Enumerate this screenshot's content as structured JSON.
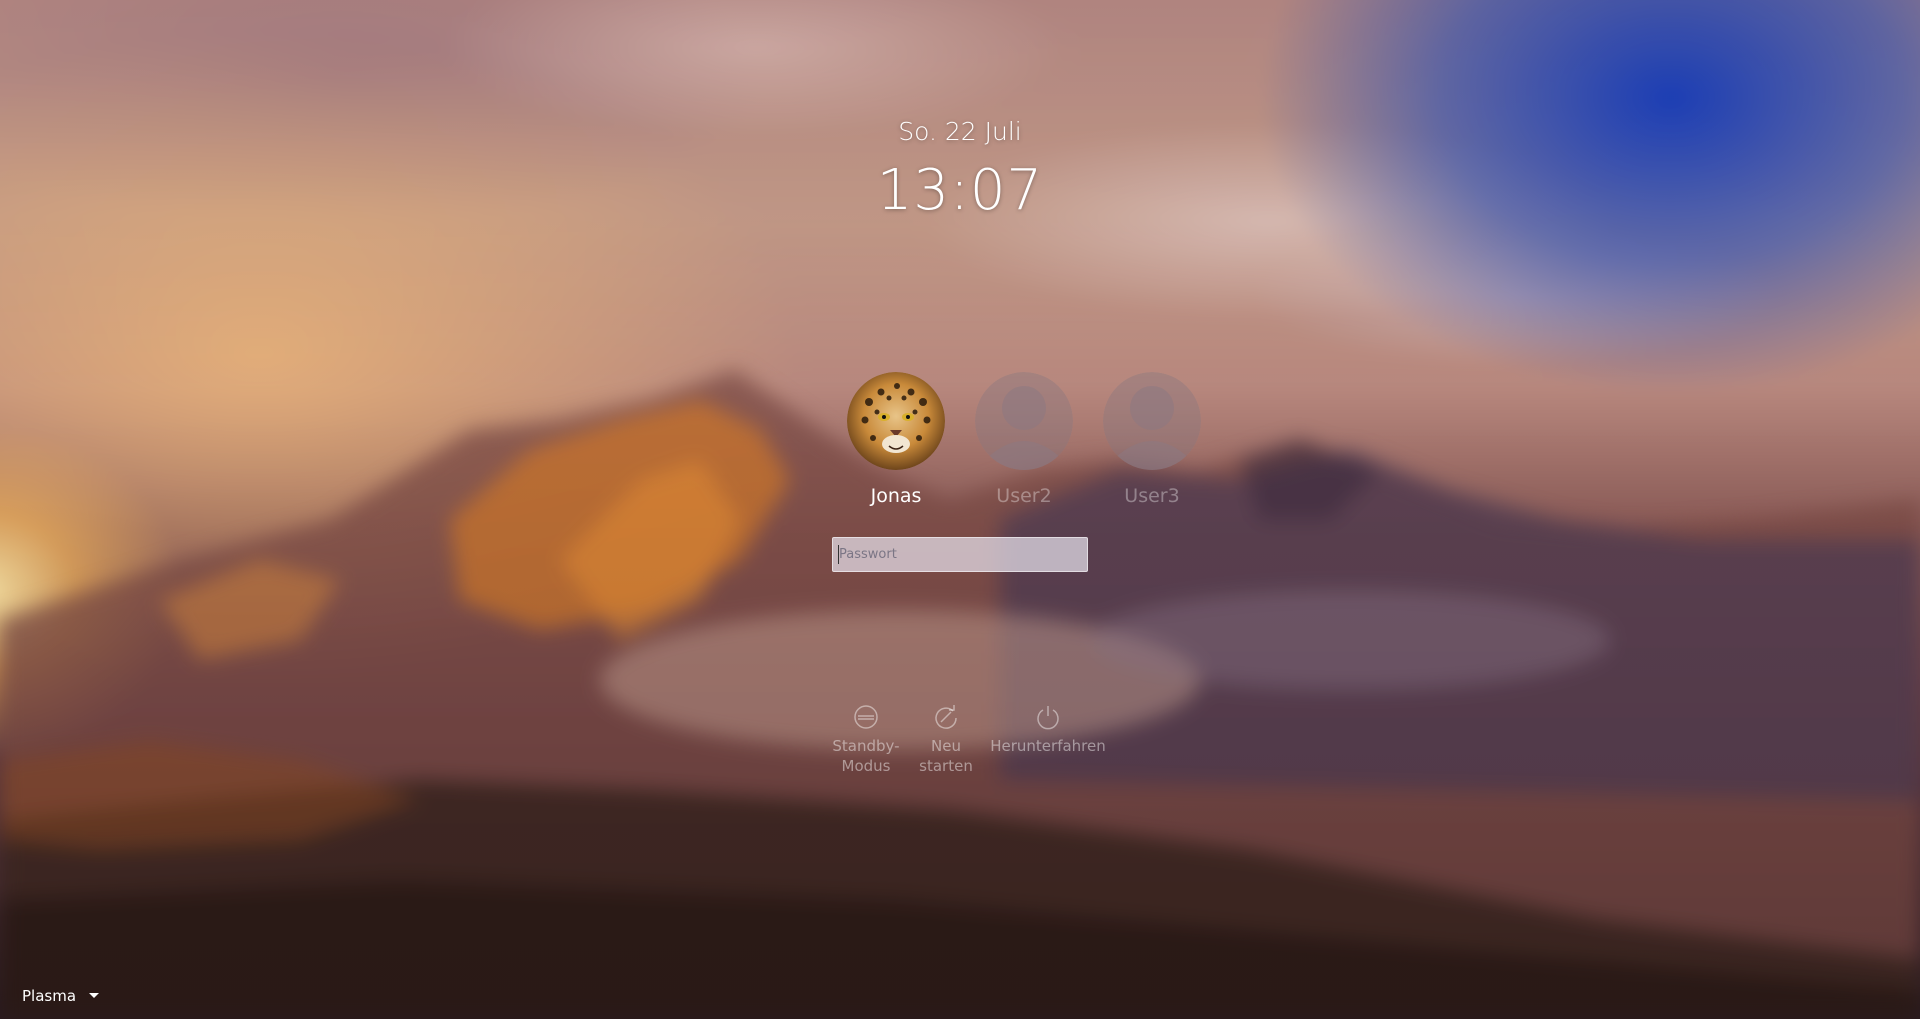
{
  "clock": {
    "date": "So. 22 Juli",
    "time": "13:07"
  },
  "users": [
    {
      "name": "Jonas",
      "avatar": "jaguar-face-photo",
      "selected": true
    },
    {
      "name": "User2",
      "avatar": "default-user-silhouette",
      "selected": false
    },
    {
      "name": "User3",
      "avatar": "default-user-silhouette",
      "selected": false
    }
  ],
  "password": {
    "placeholder": "Passwort",
    "value": ""
  },
  "actions": [
    {
      "label": "Standby-\nModus",
      "icon": "suspend-icon"
    },
    {
      "label": "Neu\nstarten",
      "icon": "reboot-icon"
    },
    {
      "label": "Herunterfahren",
      "icon": "power-icon"
    }
  ],
  "session": {
    "label": "Plasma",
    "icon": "dropdown-arrow-icon"
  },
  "colors": {
    "text": "#ffffff",
    "inactive_text": "rgba(255,255,255,0.35)",
    "field_bg": "#e6e1eb"
  }
}
